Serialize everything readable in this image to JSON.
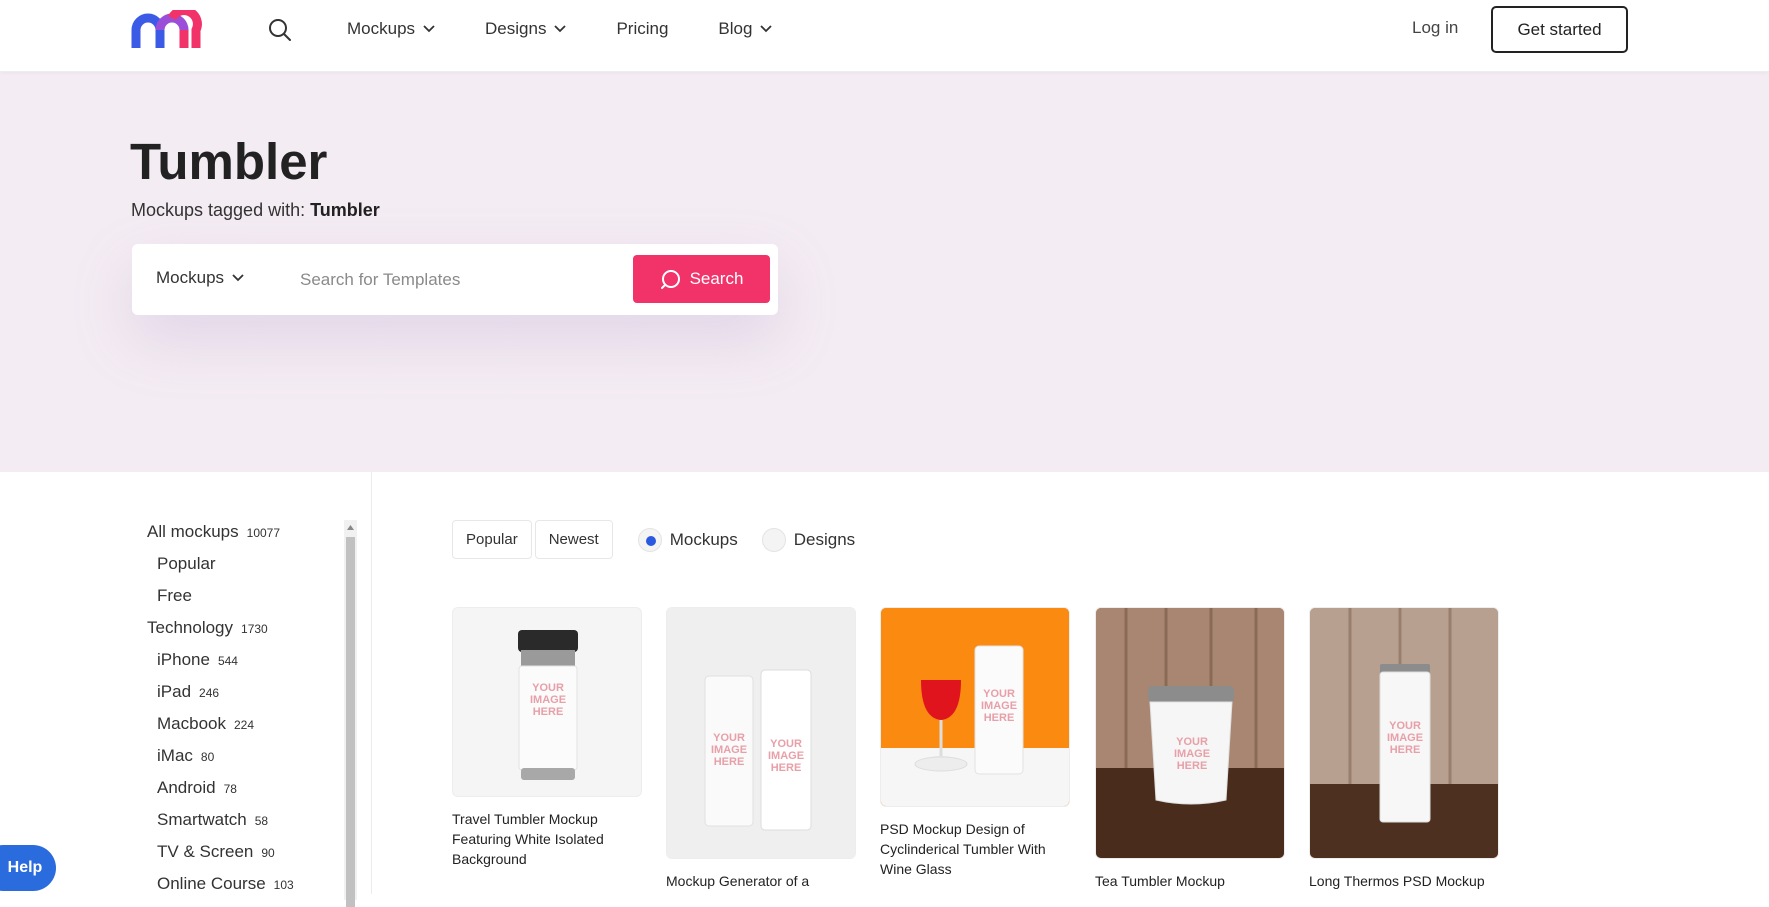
{
  "header": {
    "nav": [
      {
        "label": "Mockups",
        "has_dropdown": true
      },
      {
        "label": "Designs",
        "has_dropdown": true
      },
      {
        "label": "Pricing",
        "has_dropdown": false
      },
      {
        "label": "Blog",
        "has_dropdown": true
      }
    ],
    "login_label": "Log in",
    "cta_label": "Get started"
  },
  "hero": {
    "title": "Tumbler",
    "subtitle_prefix": "Mockups tagged with: ",
    "subtitle_tag": "Tumbler",
    "search": {
      "type_selected": "Mockups",
      "placeholder": "Search for Templates",
      "button_label": "Search"
    }
  },
  "sidebar": {
    "categories": [
      {
        "label": "All mockups",
        "count": "10077",
        "level": 0
      },
      {
        "label": "Popular",
        "count": "",
        "level": 1
      },
      {
        "label": "Free",
        "count": "",
        "level": 1
      },
      {
        "label": "Technology",
        "count": "1730",
        "level": 0
      },
      {
        "label": "iPhone",
        "count": "544",
        "level": 1
      },
      {
        "label": "iPad",
        "count": "246",
        "level": 1
      },
      {
        "label": "Macbook",
        "count": "224",
        "level": 1
      },
      {
        "label": "iMac",
        "count": "80",
        "level": 1
      },
      {
        "label": "Android",
        "count": "78",
        "level": 1
      },
      {
        "label": "Smartwatch",
        "count": "58",
        "level": 1
      },
      {
        "label": "TV & Screen",
        "count": "90",
        "level": 1
      },
      {
        "label": "Online Course",
        "count": "103",
        "level": 1
      }
    ]
  },
  "help_label": "Help",
  "filters": {
    "sort": [
      "Popular",
      "Newest"
    ],
    "types": [
      {
        "label": "Mockups",
        "selected": true
      },
      {
        "label": "Designs",
        "selected": false
      }
    ]
  },
  "thumbnail_text": "YOUR IMAGE HERE",
  "cards": [
    {
      "title": "Travel Tumbler Mockup Featuring White Isolated Background"
    },
    {
      "title": "Mockup Generator of a"
    },
    {
      "title": "PSD Mockup Design of Cyclinderical Tumbler With Wine Glass"
    },
    {
      "title": "Tea Tumbler Mockup"
    },
    {
      "title": "Long Thermos PSD Mockup"
    }
  ],
  "colors": {
    "accent": "#f2336a",
    "hero_bg": "#f4ecf3",
    "radio_selected": "#2a58e0",
    "help": "#2a6bde"
  }
}
